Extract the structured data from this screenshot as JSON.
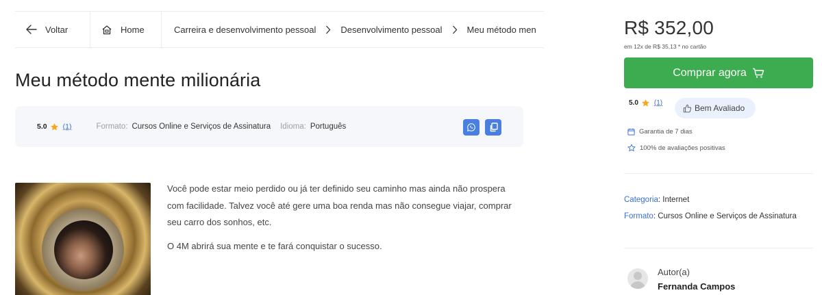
{
  "breadcrumb": {
    "back_label": "Voltar",
    "home_label": "Home",
    "path": [
      "Carreira e desenvolvimento pessoal",
      "Desenvolvimento pessoal",
      "Meu método men"
    ]
  },
  "product": {
    "title": "Meu método mente milionária",
    "rating_score": "5.0",
    "rating_count": "(1)",
    "format_label": "Formato:",
    "format_value": "Cursos Online e Serviços de Assinatura",
    "language_label": "Idioma:",
    "language_value": "Português",
    "description": [
      "Você pode estar meio perdido ou já ter definido seu caminho mas ainda não prospera com facilidade. Talvez você até gere uma boa renda mas não consegue viajar, comprar seu carro dos sonhos, etc.",
      "O 4M abrirá sua mente e te fará conquistar o sucesso."
    ]
  },
  "sidebar": {
    "price": "R$ 352,00",
    "installments": "em 12x de R$ 35,13 * no cartão",
    "buy_label": "Comprar agora",
    "rating_score": "5.0",
    "rating_count": "(1)",
    "badge_label": "Bem Avaliado",
    "guarantee": "Garantia de 7 dias",
    "positive": "100% de avaliações positivas",
    "category_label": "Categoria",
    "category_value": ": Internet",
    "format_label": "Formato",
    "format_value": ": Cursos Online e Serviços de Assinatura",
    "author_label": "Autor(a)",
    "author_name": "Fernanda Campos"
  },
  "colors": {
    "accent_green": "#3dab4f",
    "link_blue": "#3b6fd1",
    "share_blue": "#4a7fe0",
    "star": "#f2a91e"
  },
  "icons": [
    "arrow-left-icon",
    "home-icon",
    "chevron-right-icon",
    "star-icon",
    "whatsapp-icon",
    "copy-icon",
    "cart-icon",
    "thumbs-up-icon",
    "calendar-icon",
    "star-outline-icon",
    "avatar-icon"
  ]
}
